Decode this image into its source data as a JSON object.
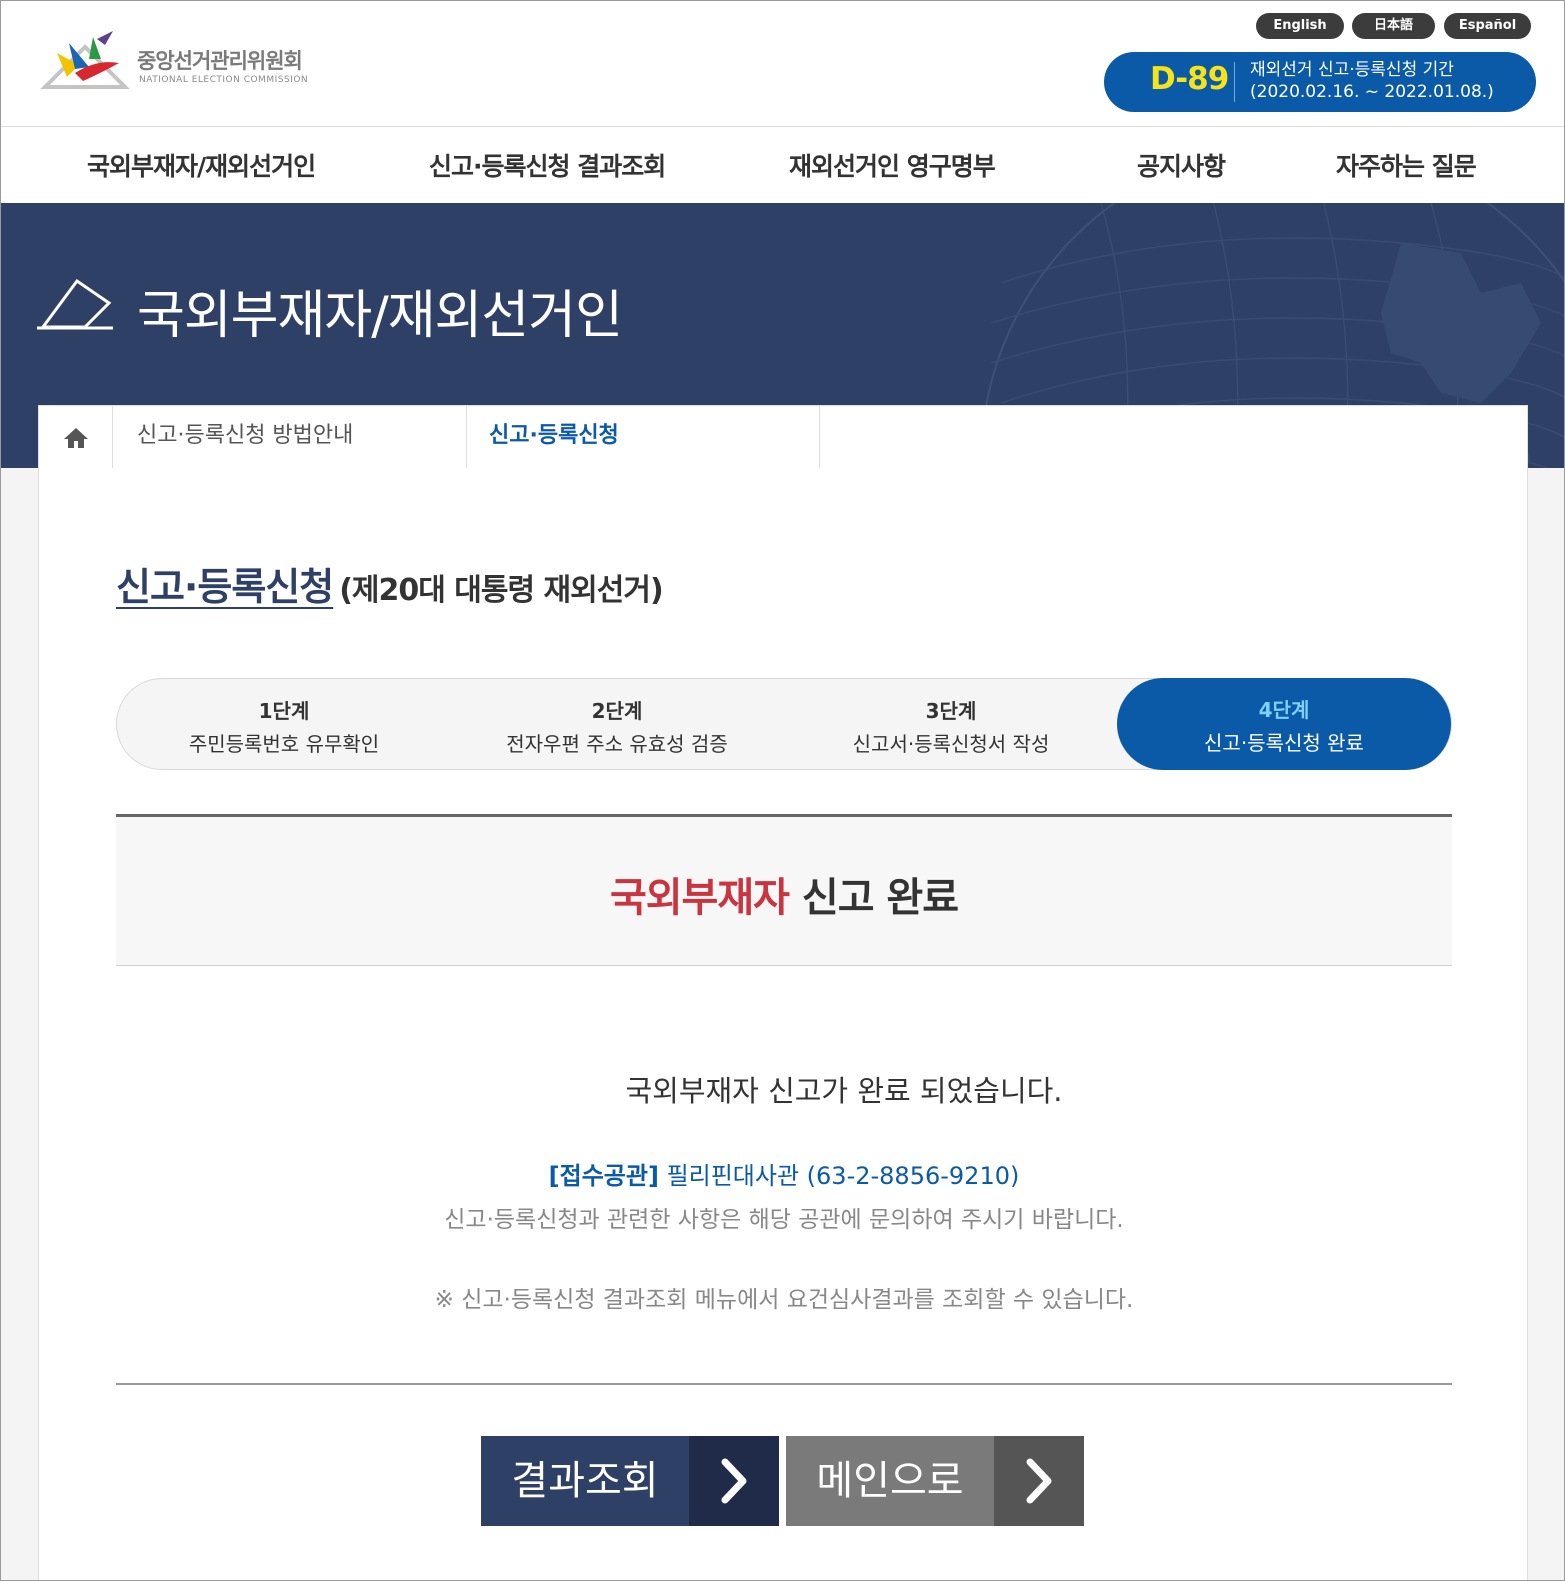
{
  "header": {
    "logo_name": "중앙선거관리위원회",
    "logo_sub": "NATIONAL ELECTION COMMISSION",
    "languages": [
      "English",
      "日本語",
      "Español"
    ],
    "dday": {
      "count": "D-89",
      "line1": "재외선거 신고·등록신청 기간",
      "line2": "(2020.02.16. ~ 2022.01.08.)"
    }
  },
  "nav": {
    "items": [
      "국외부재자/재외선거인",
      "신고·등록신청 결과조회",
      "재외선거인 영구명부",
      "공지사항",
      "자주하는 질문"
    ]
  },
  "hero": {
    "title": "국외부재자/재외선거인"
  },
  "breadcrumb": {
    "items": [
      "신고·등록신청 방법안내",
      "신고·등록신청"
    ]
  },
  "page": {
    "title": "신고·등록신청",
    "subtitle": "(제20대 대통령 재외선거)"
  },
  "steps": [
    {
      "num": "1단계",
      "label": "주민등록번호 유무확인"
    },
    {
      "num": "2단계",
      "label": "전자우편 주소 유효성 검증"
    },
    {
      "num": "3단계",
      "label": "신고서·등록신청서 작성"
    },
    {
      "num": "4단계",
      "label": "신고·등록신청 완료"
    }
  ],
  "active_step": 4,
  "result": {
    "title_red": "국외부재자",
    "title_dark": "신고 완료",
    "message": "국외부재자 신고가 완료 되었습니다.",
    "office_label": "[접수공관]",
    "office_value": "필리핀대사관 (63-2-8856-9210)",
    "contact_note": "신고·등록신청과 관련한 사항은 해당 공관에 문의하여 주시기 바랍니다.",
    "notice": "※ 신고·등록신청 결과조회 메뉴에서 요건심사결과를 조회할 수 있습니다."
  },
  "buttons": {
    "result_label": "결과조회",
    "main_label": "메인으로"
  },
  "colors": {
    "primary_blue": "#0a5aa8",
    "navy": "#2e4066",
    "accent_red": "#c9343f",
    "dday_yellow": "#f7e317"
  }
}
